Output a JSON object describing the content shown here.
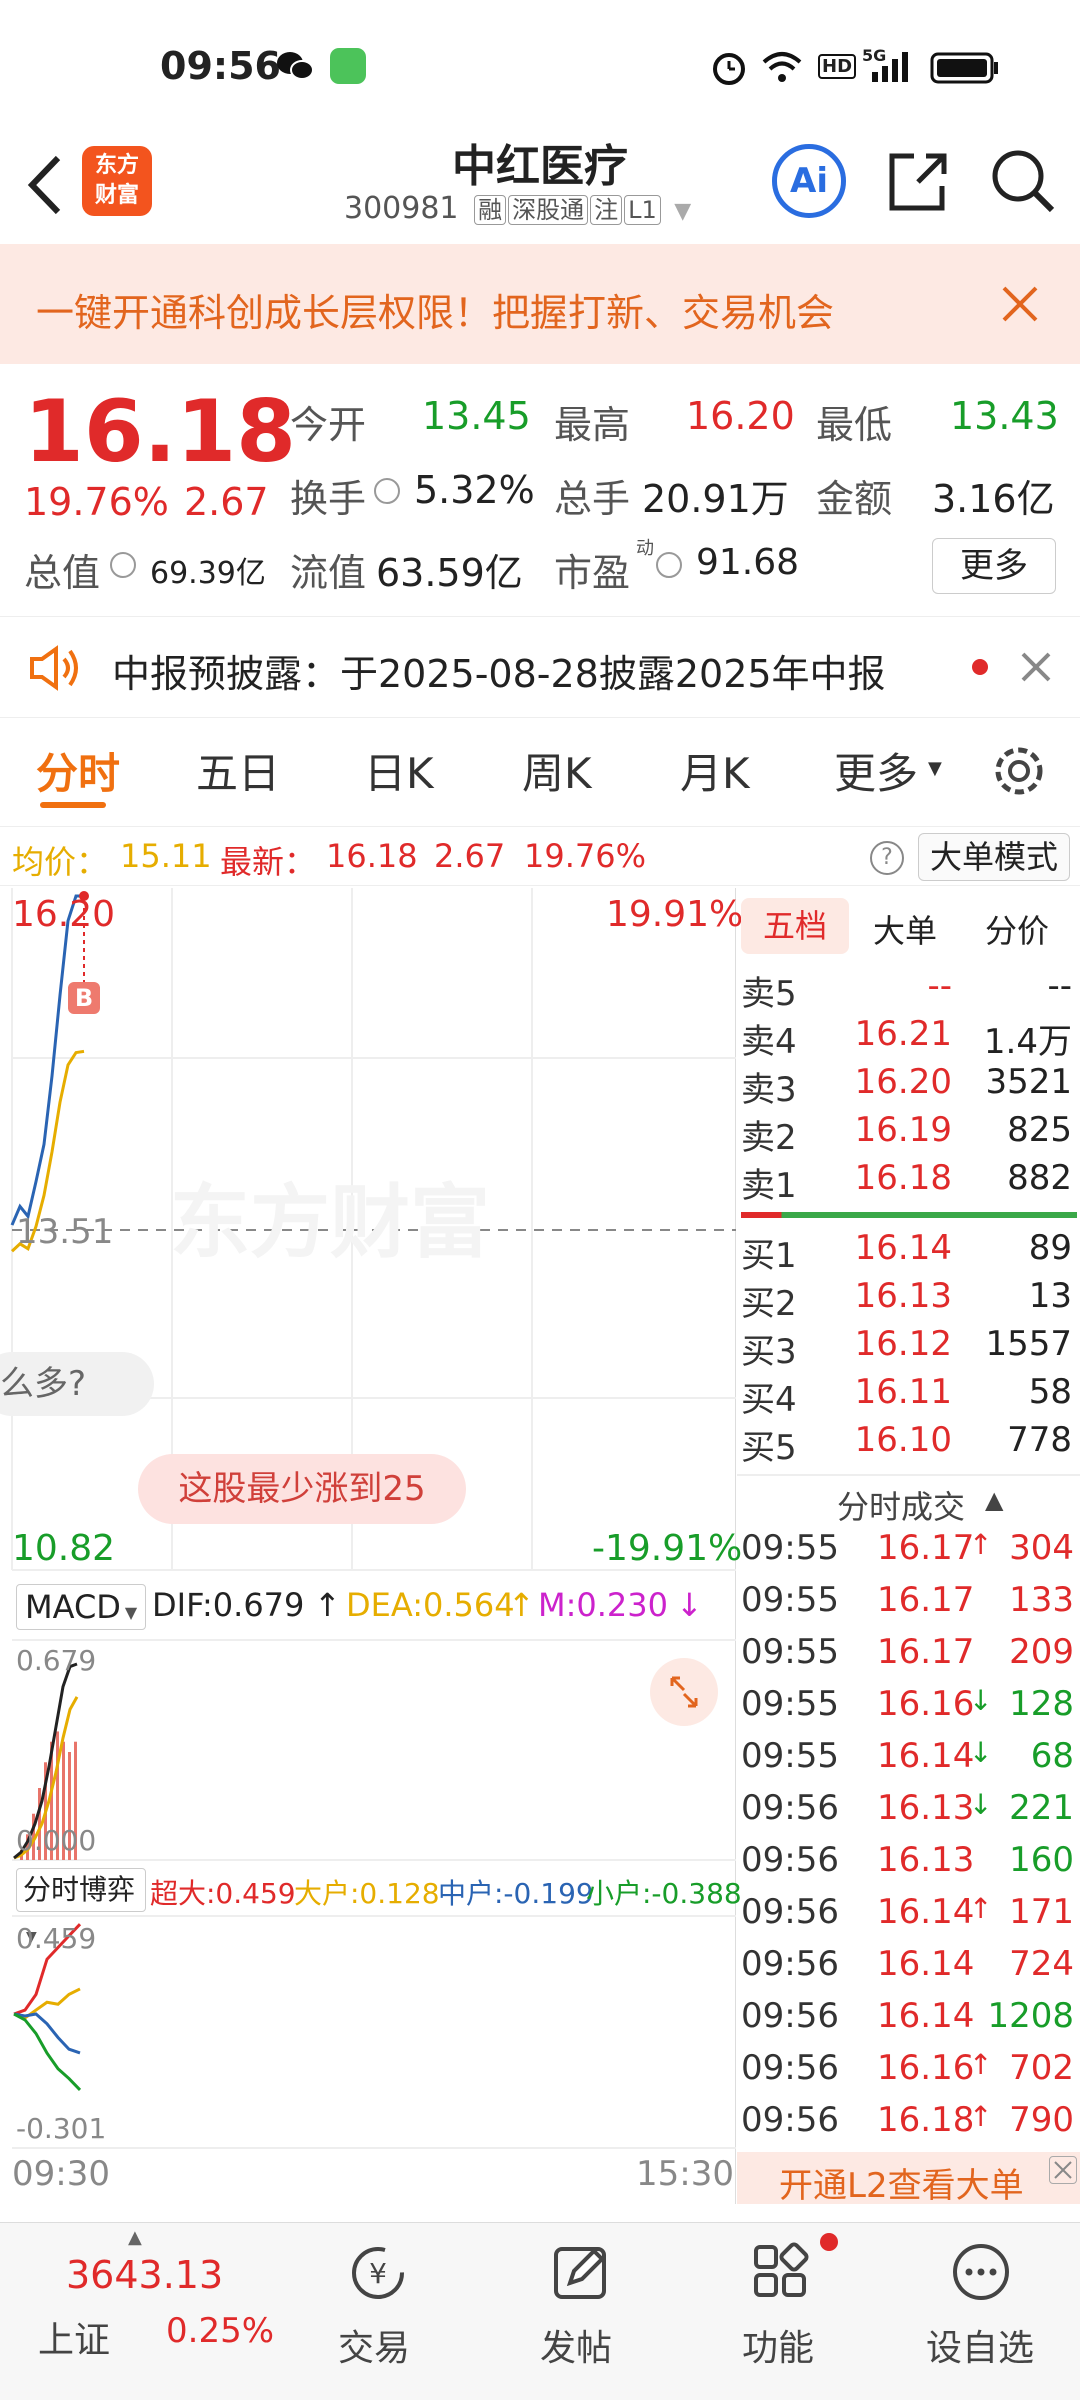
{
  "status": {
    "time": "09:56",
    "network": "5G",
    "hd": "HD"
  },
  "header": {
    "logo_line1": "东方",
    "logo_line2": "财富",
    "title": "中红医疗",
    "code": "300981",
    "tags": [
      "融",
      "深股通",
      "注",
      "L1"
    ],
    "ai_label": "Ai"
  },
  "banner": {
    "text": "一键开通科创成长层权限！把握打新、交易机会"
  },
  "quote": {
    "price": "16.18",
    "change_pct": "19.76%",
    "change": "2.67",
    "open_label": "今开",
    "open": "13.45",
    "high_label": "最高",
    "high": "16.20",
    "low_label": "最低",
    "low": "13.43",
    "turnover_label": "换手",
    "turnover": "5.32%",
    "volume_label": "总手",
    "volume": "20.91万",
    "amount_label": "金额",
    "amount": "3.16亿",
    "mktcap_label": "总值",
    "mktcap": "69.39亿",
    "float_label": "流值",
    "float": "63.59亿",
    "pe_label": "市盈",
    "pe_sup": "动",
    "pe": "91.68",
    "more_label": "更多"
  },
  "notice": {
    "text": "中报预披露：于2025-08-28披露2025年中报"
  },
  "tabs": [
    "分时",
    "五日",
    "日K",
    "周K",
    "月K",
    "更多"
  ],
  "infobar": {
    "avg_label": "均价：",
    "avg": "15.11",
    "latest_label": "最新：",
    "latest": "16.18",
    "change": "2.67",
    "pct": "19.76%",
    "mode_label": "大单模式",
    "help": "?"
  },
  "chart": {
    "top_price": "16.20",
    "top_pct": "19.91%",
    "mid_price": "13.51",
    "bottom_price": "10.82",
    "bottom_pct": "-19.91%",
    "watermark": "东方财富",
    "buy_marker": "B",
    "chat_bubble": "么多?",
    "hint_bubble": "这股最少涨到25",
    "macd": {
      "label": "MACD",
      "dif": "DIF:0.679",
      "dea": "DEA:0.564",
      "m": "M:0.230",
      "top": "0.679",
      "bottom": "0.000"
    },
    "fund": {
      "label": "分时博弈",
      "super": "超大:0.459",
      "big": "大户:0.128",
      "mid": "中户:-0.199",
      "small": "小户:-0.388",
      "top": "0.459",
      "bottom": "-0.301"
    },
    "time_start": "09:30",
    "time_end": "15:30",
    "price_min": 10.82,
    "price_max": 16.2,
    "prev_close": 13.51,
    "price_line": [
      13.55,
      13.7,
      13.62,
      13.9,
      14.2,
      14.75,
      15.4,
      16.0,
      16.2,
      16.2
    ],
    "avg_line": [
      13.5,
      13.56,
      13.52,
      13.7,
      13.95,
      14.3,
      14.7,
      15.0,
      15.1,
      15.11
    ],
    "macd_dif": [
      0.0,
      0.02,
      0.06,
      0.12,
      0.2,
      0.32,
      0.46,
      0.6,
      0.67,
      0.679
    ],
    "macd_dea": [
      0.0,
      0.01,
      0.03,
      0.07,
      0.12,
      0.2,
      0.3,
      0.42,
      0.52,
      0.564
    ],
    "macd_bars": [
      0.02,
      0.05,
      0.09,
      0.14,
      0.19,
      0.23,
      0.25,
      0.23,
      0.21,
      0.23
    ],
    "fund_super": [
      0.0,
      0.02,
      0.1,
      0.28,
      0.34,
      0.4,
      0.459
    ],
    "fund_big": [
      0.0,
      -0.02,
      0.02,
      0.06,
      0.05,
      0.1,
      0.128
    ],
    "fund_mid": [
      0.0,
      -0.01,
      0.0,
      -0.05,
      -0.12,
      -0.18,
      -0.199
    ],
    "fund_small": [
      0.0,
      -0.03,
      -0.1,
      -0.2,
      -0.28,
      -0.33,
      -0.388
    ]
  },
  "orderbook": {
    "tabs": [
      "五档",
      "大单",
      "分价"
    ],
    "asks": [
      {
        "label": "卖5",
        "price": "--",
        "vol": "--"
      },
      {
        "label": "卖4",
        "price": "16.21",
        "vol": "1.4万"
      },
      {
        "label": "卖3",
        "price": "16.20",
        "vol": "3521"
      },
      {
        "label": "卖2",
        "price": "16.19",
        "vol": "825"
      },
      {
        "label": "卖1",
        "price": "16.18",
        "vol": "882"
      }
    ],
    "bids": [
      {
        "label": "买1",
        "price": "16.14",
        "vol": "89"
      },
      {
        "label": "买2",
        "price": "16.13",
        "vol": "13"
      },
      {
        "label": "买3",
        "price": "16.12",
        "vol": "1557"
      },
      {
        "label": "买4",
        "price": "16.11",
        "vol": "58"
      },
      {
        "label": "买5",
        "price": "16.10",
        "vol": "778"
      }
    ],
    "trades_title": "分时成交",
    "trades": [
      {
        "time": "09:55",
        "price": "16.17",
        "arrow": "↑",
        "vol": "304",
        "dir": "red"
      },
      {
        "time": "09:55",
        "price": "16.17",
        "arrow": "",
        "vol": "133",
        "dir": "red"
      },
      {
        "time": "09:55",
        "price": "16.17",
        "arrow": "",
        "vol": "209",
        "dir": "red"
      },
      {
        "time": "09:55",
        "price": "16.16",
        "arrow": "↓",
        "vol": "128",
        "dir": "green"
      },
      {
        "time": "09:55",
        "price": "16.14",
        "arrow": "↓",
        "vol": "68",
        "dir": "green"
      },
      {
        "time": "09:56",
        "price": "16.13",
        "arrow": "↓",
        "vol": "221",
        "dir": "green"
      },
      {
        "time": "09:56",
        "price": "16.13",
        "arrow": "",
        "vol": "160",
        "dir": "green"
      },
      {
        "time": "09:56",
        "price": "16.14",
        "arrow": "↑",
        "vol": "171",
        "dir": "red"
      },
      {
        "time": "09:56",
        "price": "16.14",
        "arrow": "",
        "vol": "724",
        "dir": "red"
      },
      {
        "time": "09:56",
        "price": "16.14",
        "arrow": "",
        "vol": "1208",
        "dir": "green"
      },
      {
        "time": "09:56",
        "price": "16.16",
        "arrow": "↑",
        "vol": "702",
        "dir": "red"
      },
      {
        "time": "09:56",
        "price": "16.18",
        "arrow": "↑",
        "vol": "790",
        "dir": "red"
      }
    ],
    "l2_label": "开通L2查看大单"
  },
  "bottom": {
    "index_value": "3643.13",
    "index_name": "上证",
    "index_pct": "0.25%",
    "nav": [
      {
        "label": "交易",
        "icon": "trade-icon"
      },
      {
        "label": "发帖",
        "icon": "post-icon"
      },
      {
        "label": "功能",
        "icon": "apps-icon"
      },
      {
        "label": "设自选",
        "icon": "more-icon"
      }
    ]
  },
  "colors": {
    "up": "#e02a2a",
    "down": "#189d29",
    "accent": "#f07010",
    "avg": "#e6ad00",
    "price": "#2a64b3"
  }
}
